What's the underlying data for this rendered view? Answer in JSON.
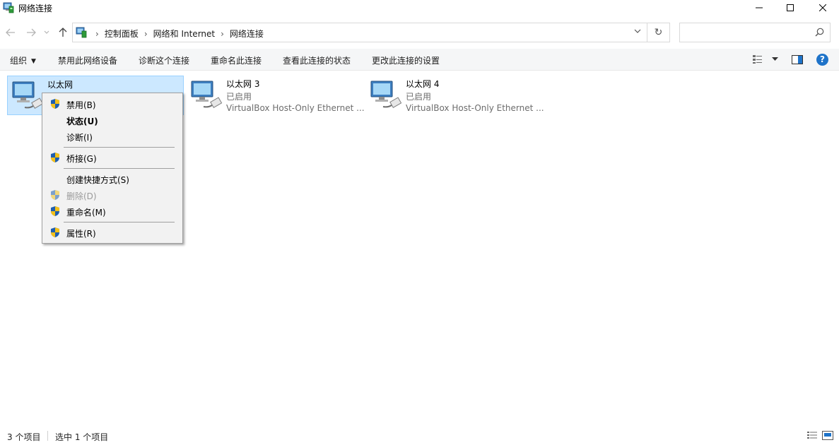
{
  "window": {
    "title": "网络连接",
    "icons": {
      "app": "network-connections-icon",
      "minimize": "minimize-icon",
      "maximize": "maximize-icon",
      "close": "close-icon"
    }
  },
  "nav": {
    "breadcrumbs": [
      "控制面板",
      "网络和 Internet",
      "网络连接"
    ],
    "search_placeholder": "",
    "refresh_glyph": "↻",
    "icons": {
      "back": "back-arrow-icon",
      "forward": "forward-arrow-icon",
      "recent": "chevron-down-icon",
      "up": "up-arrow-icon",
      "search": "search-icon"
    }
  },
  "commands": {
    "organize": "组织",
    "disable_device": "禁用此网络设备",
    "diagnose": "诊断这个连接",
    "rename": "重命名此连接",
    "view_status": "查看此连接的状态",
    "change_settings": "更改此连接的设置"
  },
  "items": [
    {
      "name": "以太网",
      "status": "",
      "device": "",
      "selected": true
    },
    {
      "name": "以太网 3",
      "status": "已启用",
      "device": "VirtualBox Host-Only Ethernet ...",
      "selected": false
    },
    {
      "name": "以太网 4",
      "status": "已启用",
      "device": "VirtualBox Host-Only Ethernet ...",
      "selected": false
    }
  ],
  "context_menu": {
    "disable": "禁用(B)",
    "status": "状态(U)",
    "diagnose": "诊断(I)",
    "bridge": "桥接(G)",
    "shortcut": "创建快捷方式(S)",
    "delete": "删除(D)",
    "rename": "重命名(M)",
    "properties": "属性(R)"
  },
  "statusbar": {
    "item_count": "3 个项目",
    "selected_count": "选中 1 个项目"
  },
  "colors": {
    "selection_bg": "#cce8ff",
    "selection_border": "#99d1ff",
    "help": "#1e73c9",
    "menu_bg": "#f2f2f2"
  }
}
